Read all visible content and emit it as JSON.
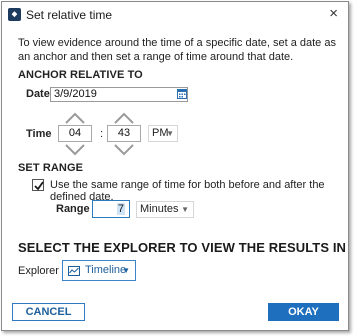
{
  "window": {
    "title": "Set relative time",
    "app_icon": "magnet-app-icon",
    "close_glyph": "×"
  },
  "description": "To view evidence around the time of a specific date, set a date as an anchor and then set a range of time around that date.",
  "anchor": {
    "heading": "ANCHOR RELATIVE TO",
    "date_label": "Date",
    "date_value": "3/9/2019",
    "time_label": "Time",
    "hour": "04",
    "minute": "43",
    "separator": ":",
    "ampm": "PM"
  },
  "range": {
    "heading": "SET RANGE",
    "same_range_checked": true,
    "same_range_label": "Use the same range of time for both before and after the defined date.",
    "range_label": "Range",
    "range_value": "7",
    "units": "Minutes"
  },
  "explorer": {
    "heading": "SELECT THE EXPLORER TO VIEW THE RESULTS IN",
    "label": "Explorer",
    "selected": "Timeline"
  },
  "buttons": {
    "cancel": "CANCEL",
    "okay": "OKAY"
  },
  "colors": {
    "accent": "#1e6fbe",
    "border_light": "#a9a9a9"
  }
}
